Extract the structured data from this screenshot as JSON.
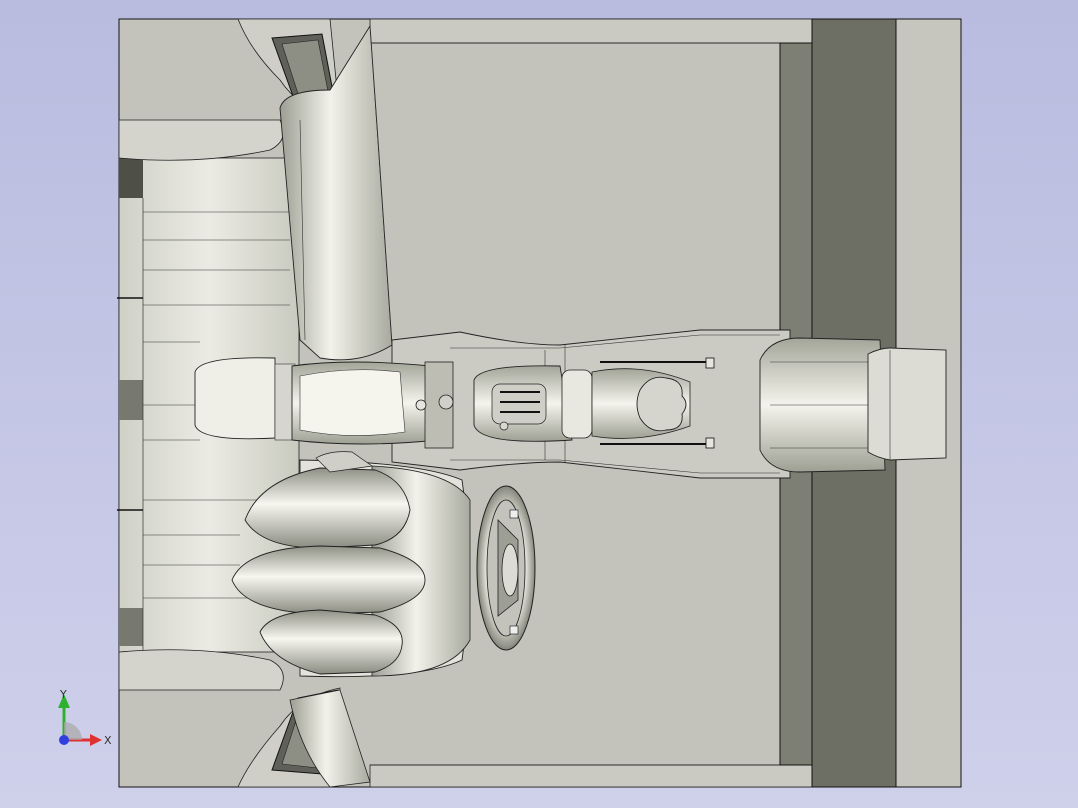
{
  "window": {
    "title": ""
  },
  "colors": {
    "background_top": "#b9bcdf",
    "background_bottom": "#cfd0ea",
    "floor": "#c3c3bb",
    "panel_dark": "#6e6f64",
    "panel_mid": "#7d7e74",
    "body_light": "#dcdcd3",
    "edge": "#111111",
    "axis_x": "#e03030",
    "axis_y": "#30b030",
    "axis_z": "#3040e0"
  },
  "triad": {
    "x_label": "X",
    "y_label": "Y"
  }
}
